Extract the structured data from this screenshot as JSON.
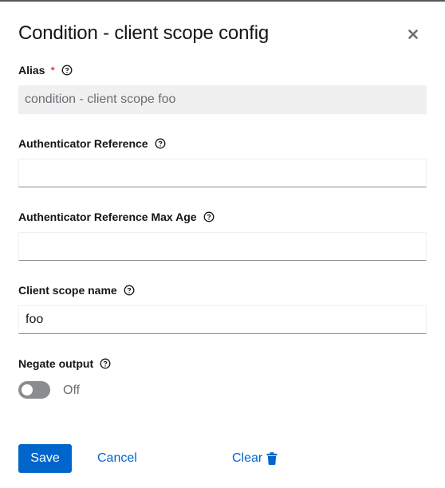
{
  "modal": {
    "title": "Condition - client scope config",
    "close_icon": "close-icon"
  },
  "fields": {
    "alias": {
      "label": "Alias",
      "required_marker": "*",
      "value": "condition - client scope foo",
      "disabled": true,
      "help_icon": "help-circle-icon"
    },
    "authenticator_reference": {
      "label": "Authenticator Reference",
      "value": "",
      "help_icon": "help-circle-icon"
    },
    "authenticator_reference_max_age": {
      "label": "Authenticator Reference Max Age",
      "value": "",
      "help_icon": "help-circle-icon"
    },
    "client_scope_name": {
      "label": "Client scope name",
      "value": "foo",
      "help_icon": "help-circle-icon"
    },
    "negate_output": {
      "label": "Negate output",
      "state_label": "Off",
      "checked": false,
      "help_icon": "help-circle-icon"
    }
  },
  "actions": {
    "save_label": "Save",
    "cancel_label": "Cancel",
    "clear_label": "Clear",
    "clear_icon": "trash-icon"
  },
  "colors": {
    "primary": "#0066cc",
    "required": "#c9190b",
    "switch_off": "#8a8d90",
    "disabled_bg": "#f0f0f0"
  }
}
